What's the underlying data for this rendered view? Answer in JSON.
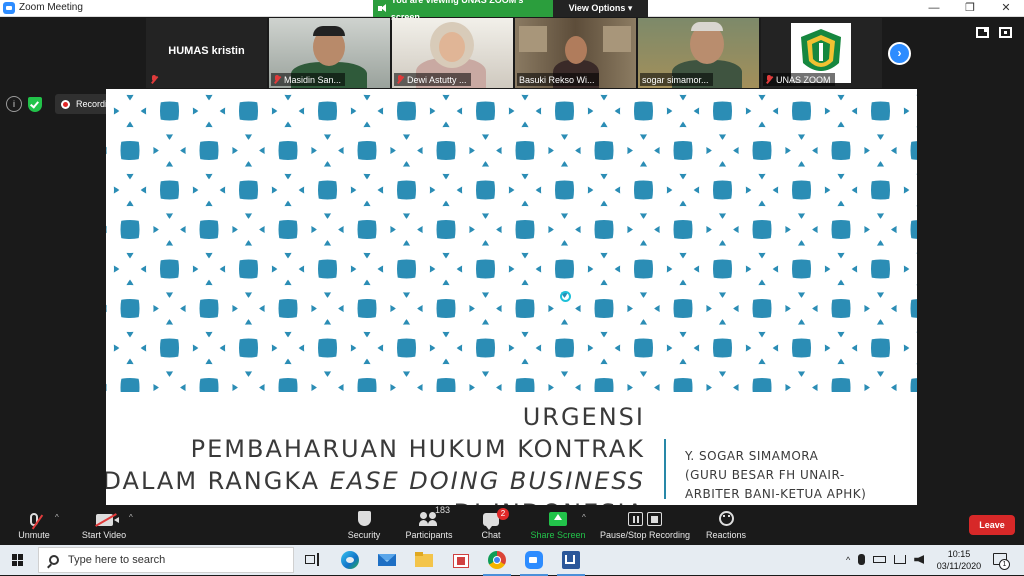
{
  "window": {
    "title": "Zoom Meeting",
    "minimize_glyph": "—",
    "restore_glyph": "❐",
    "close_glyph": "✕"
  },
  "share_banner": {
    "viewing_text": "You are viewing UNAS ZOOM's screen",
    "view_options": "View Options ▾"
  },
  "participants_strip": [
    {
      "name": "HUMAS kristin"
    },
    {
      "name": "Masidin San..."
    },
    {
      "name": "Dewi Astutty ..."
    },
    {
      "name": "Basuki Rekso Wi..."
    },
    {
      "name": "sogar simamor..."
    },
    {
      "name": "UNAS ZOOM"
    }
  ],
  "next_page_glyph": "›",
  "info_glyph": "i",
  "recording": {
    "label": "Recording..."
  },
  "slide": {
    "title_line1": "URGENSI",
    "title_line2": "PEMBAHARUAN HUKUM KONTRAK",
    "title_line3_plain": "DALAM RANGKA ",
    "title_line3_italic": "EASE DOING BUSINESS",
    "title_line4": "DI INDONESIA",
    "author_line1": "Y. SOGAR SIMAMORA",
    "author_line2": "(GURU BESAR FH UNAIR-",
    "author_line3": "ARBITER BANI-KETUA APHK)",
    "colors": {
      "pattern_blue": "#2b8db5",
      "text": "#3a3a3a"
    }
  },
  "toolbar": {
    "unmute": "Unmute",
    "start_video": "Start Video",
    "security": "Security",
    "participants": "Participants",
    "participants_count": "183",
    "chat": "Chat",
    "chat_badge": "2",
    "share_screen": "Share Screen",
    "record": "Pause/Stop Recording",
    "reactions": "Reactions",
    "leave": "Leave",
    "caret": "^"
  },
  "taskbar": {
    "search_placeholder": "Type here to search",
    "time": "10:15",
    "date": "03/11/2020",
    "notification_count": "1",
    "tray_caret": "^"
  }
}
